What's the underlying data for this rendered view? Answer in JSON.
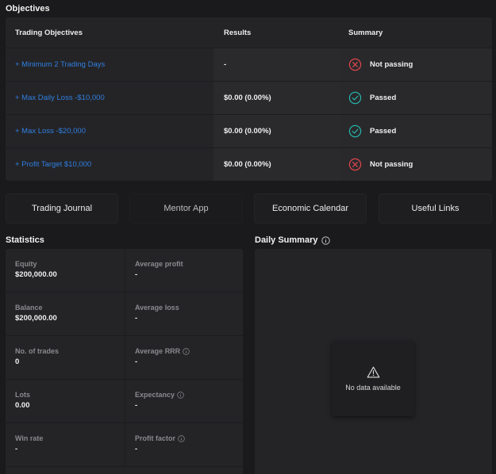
{
  "objectives": {
    "title": "Objectives",
    "headers": {
      "objective": "Trading Objectives",
      "results": "Results",
      "summary": "Summary"
    },
    "rows": [
      {
        "objective": "+ Minimum 2 Trading Days",
        "result": "-",
        "status": "Not passing",
        "status_icon": "x-circle-icon"
      },
      {
        "objective": "+ Max Daily Loss -$10,000",
        "result": "$0.00 (0.00%)",
        "status": "Passed",
        "status_icon": "check-circle-icon"
      },
      {
        "objective": "+ Max Loss -$20,000",
        "result": "$0.00 (0.00%)",
        "status": "Passed",
        "status_icon": "check-circle-icon"
      },
      {
        "objective": "+ Profit Target $10,000",
        "result": "$0.00 (0.00%)",
        "status": "Not passing",
        "status_icon": "x-circle-icon"
      }
    ]
  },
  "tabs": [
    {
      "label": "Trading Journal"
    },
    {
      "label": "Mentor App"
    },
    {
      "label": "Economic Calendar"
    },
    {
      "label": "Useful Links"
    }
  ],
  "statistics": {
    "title": "Statistics",
    "rows": [
      {
        "left": {
          "label": "Equity",
          "value": "$200,000.00"
        },
        "right": {
          "label": "Average profit",
          "value": "-"
        }
      },
      {
        "left": {
          "label": "Balance",
          "value": "$200,000.00"
        },
        "right": {
          "label": "Average loss",
          "value": "-"
        }
      },
      {
        "left": {
          "label": "No. of trades",
          "value": "0"
        },
        "right": {
          "label": "Average RRR",
          "value": "-"
        }
      },
      {
        "left": {
          "label": "Lots",
          "value": "0.00"
        },
        "right": {
          "label": "Expectancy",
          "value": "-"
        }
      },
      {
        "left": {
          "label": "Win rate",
          "value": "-"
        },
        "right": {
          "label": "Profit factor",
          "value": "-"
        }
      }
    ]
  },
  "daily_summary": {
    "title": "Daily Summary",
    "empty_text": "No data available"
  },
  "colors": {
    "link": "#2f7fe0",
    "fail": "#e0454b",
    "pass": "#26b3a8"
  }
}
